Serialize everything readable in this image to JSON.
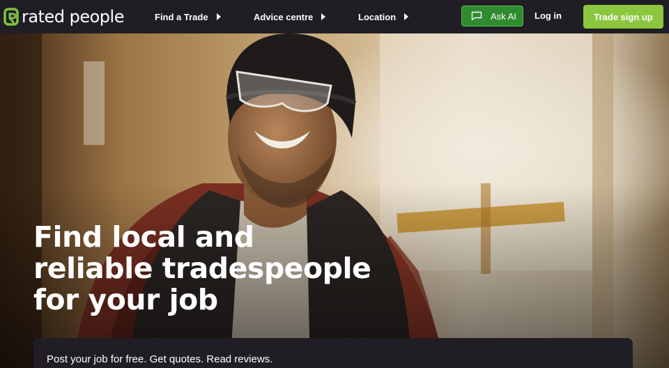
{
  "header": {
    "logo_text": "rated people",
    "nav": [
      {
        "label": "Find a Trade"
      },
      {
        "label": "Advice centre"
      },
      {
        "label": "Location"
      }
    ],
    "ask_ai_label": "Ask AI",
    "login_label": "Log in",
    "signup_label": "Trade sign up"
  },
  "hero": {
    "title_lines": [
      "Find local and",
      "reliable tradespeople",
      "for your job"
    ],
    "tagline": "Post your job for free. Get quotes. Read reviews."
  },
  "colors": {
    "nav_bg": "#211d24",
    "brand_green": "#8cc63f",
    "ask_ai_green": "#2e8b2e",
    "logo_green": "#7dc242"
  }
}
